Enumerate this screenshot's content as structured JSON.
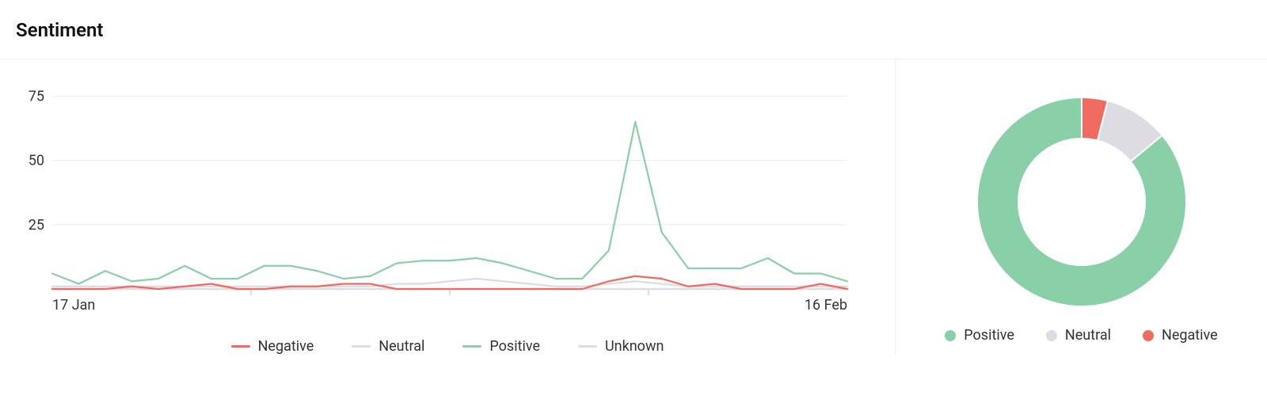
{
  "title": "Sentiment",
  "colors": {
    "positive": "#89cfa8",
    "neutral": "#dcdce2",
    "negative": "#f06a5f",
    "unknown": "#dcdce2",
    "grid": "#ececec",
    "axis": "#666"
  },
  "line_legend": [
    {
      "name": "Negative",
      "key": "negative"
    },
    {
      "name": "Neutral",
      "key": "neutral"
    },
    {
      "name": "Positive",
      "key": "positive"
    },
    {
      "name": "Unknown",
      "key": "unknown"
    }
  ],
  "donut_legend": [
    {
      "name": "Positive",
      "key": "positive"
    },
    {
      "name": "Neutral",
      "key": "neutral"
    },
    {
      "name": "Negative",
      "key": "negative"
    }
  ],
  "chart_data": [
    {
      "type": "line",
      "title": "Sentiment",
      "xlabel": "",
      "ylabel": "",
      "ylim": [
        0,
        80
      ],
      "yticks": [
        25,
        50,
        75
      ],
      "x_labels": {
        "0": "17 Jan",
        "30": "16 Feb"
      },
      "x": [
        0,
        1,
        2,
        3,
        4,
        5,
        6,
        7,
        8,
        9,
        10,
        11,
        12,
        13,
        14,
        15,
        16,
        17,
        18,
        19,
        20,
        21,
        22,
        23,
        24,
        25,
        26,
        27,
        28,
        29,
        30
      ],
      "series": [
        {
          "name": "Positive",
          "key": "positive",
          "values": [
            6,
            2,
            7,
            3,
            4,
            9,
            4,
            4,
            9,
            9,
            7,
            4,
            5,
            10,
            11,
            11,
            12,
            10,
            7,
            4,
            4,
            15,
            65,
            22,
            8,
            8,
            8,
            12,
            6,
            6,
            3
          ]
        },
        {
          "name": "Neutral",
          "key": "neutral",
          "values": [
            1,
            1,
            1,
            1,
            1,
            1,
            1,
            1,
            1,
            1,
            1,
            1,
            1,
            2,
            2,
            3,
            4,
            3,
            2,
            1,
            1,
            2,
            3,
            2,
            1,
            1,
            1,
            1,
            1,
            1,
            1
          ]
        },
        {
          "name": "Unknown",
          "key": "unknown",
          "values": [
            0,
            0,
            0,
            0,
            0,
            0,
            0,
            0,
            0,
            0,
            0,
            0,
            0,
            0,
            0,
            0,
            0,
            0,
            0,
            0,
            0,
            0,
            0,
            0,
            0,
            0,
            0,
            0,
            0,
            0,
            0
          ]
        },
        {
          "name": "Negative",
          "key": "negative",
          "values": [
            0,
            0,
            0,
            1,
            0,
            1,
            2,
            0,
            0,
            1,
            1,
            2,
            2,
            0,
            0,
            0,
            0,
            0,
            0,
            0,
            0,
            3,
            5,
            4,
            1,
            2,
            0,
            0,
            0,
            2,
            0
          ]
        }
      ]
    },
    {
      "type": "pie",
      "title": "Sentiment",
      "series": [
        {
          "name": "Positive",
          "key": "positive",
          "value": 86
        },
        {
          "name": "Neutral",
          "key": "neutral",
          "value": 10
        },
        {
          "name": "Negative",
          "key": "negative",
          "value": 4
        }
      ]
    }
  ]
}
